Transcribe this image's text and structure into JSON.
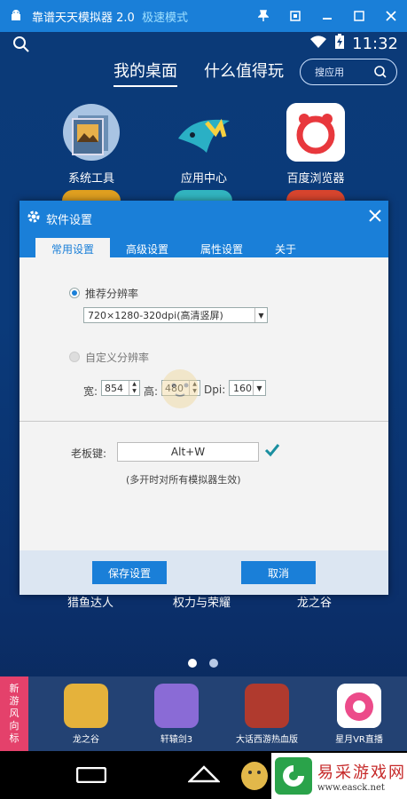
{
  "window": {
    "title": "靠谱天天模拟器",
    "version": "2.0",
    "mode": "极速模式",
    "controls": {
      "pin": "pin-icon",
      "restore": "restore-icon",
      "minimize": "minimize-icon",
      "maximize": "maximize-icon",
      "close": "close-icon"
    }
  },
  "status": {
    "time": "11:32"
  },
  "home": {
    "tabs": [
      {
        "label": "我的桌面",
        "active": true
      },
      {
        "label": "什么值得玩",
        "active": false
      }
    ],
    "search_placeholder": "搜应用",
    "apps": [
      {
        "label": "系统工具",
        "icon": "system-tools-icon"
      },
      {
        "label": "应用中心",
        "icon": "app-center-icon"
      },
      {
        "label": "百度浏览器",
        "icon": "baidu-browser-icon"
      }
    ],
    "bottom_labels": [
      "猎鱼达人",
      "权力与荣耀",
      "龙之谷"
    ]
  },
  "dock": {
    "tag": [
      "新",
      "游",
      "风",
      "向",
      "标"
    ],
    "apps": [
      {
        "label": "龙之谷"
      },
      {
        "label": "轩辕剑3"
      },
      {
        "label": "大话西游热血版"
      },
      {
        "label": "星月VR直播"
      }
    ]
  },
  "dialog": {
    "title": "软件设置",
    "tabs": [
      {
        "label": "常用设置",
        "active": true
      },
      {
        "label": "高级设置",
        "active": false
      },
      {
        "label": "属性设置",
        "active": false
      },
      {
        "label": "关于",
        "active": false
      }
    ],
    "recommended": {
      "label": "推荐分辨率",
      "selected": true,
      "value": "720×1280-320dpi(高清竖屏)"
    },
    "custom": {
      "label": "自定义分辨率",
      "selected": false,
      "width_label": "宽:",
      "width_value": "854",
      "height_label": "高:",
      "height_value": "480",
      "dpi_label": "Dpi:",
      "dpi_value": "160"
    },
    "boss_key": {
      "label": "老板键:",
      "value": "Alt+W",
      "note": "(多开时对所有模拟器生效)"
    },
    "buttons": {
      "save": "保存设置",
      "cancel": "取消"
    }
  },
  "watermark": {
    "name": "易采游戏网",
    "url": "www.easck.net"
  }
}
